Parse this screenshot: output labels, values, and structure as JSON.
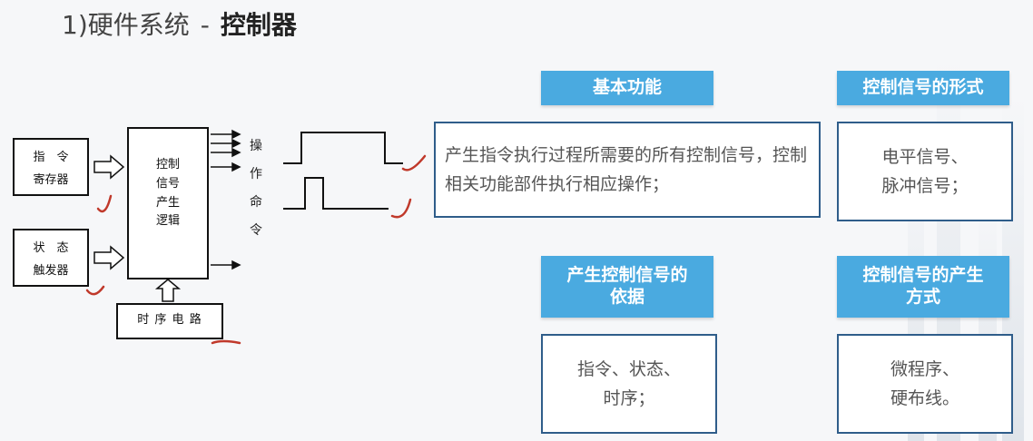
{
  "title": {
    "prefix": "1)硬件系统",
    "separator": "-",
    "emphasis": "控制器"
  },
  "diagram": {
    "instruction_register": [
      "指　令",
      "寄存器"
    ],
    "status_trigger": [
      "状　态",
      "触发器"
    ],
    "control_logic": [
      "控制",
      "信号",
      "产生",
      "逻辑"
    ],
    "timing_circuit": "时 序 电 路",
    "op_command": [
      "操",
      "作",
      "命",
      "令"
    ]
  },
  "cards": {
    "basic_function": {
      "heading": "基本功能",
      "body": "产生指令执行过程所需要的所有控制信号，控制相关功能部件执行相应操作；"
    },
    "signal_form": {
      "heading": "控制信号的形式",
      "body_lines": [
        "电平信号、",
        "脉冲信号；"
      ]
    },
    "signal_basis": {
      "heading_lines": [
        "产生控制信号的",
        "依据"
      ],
      "body_lines": [
        "指令、状态、",
        "时序；"
      ]
    },
    "signal_method": {
      "heading_lines": [
        "控制信号的产生",
        "方式"
      ],
      "body_lines": [
        "微程序、",
        "硬布线。"
      ]
    }
  },
  "colors": {
    "accent": "#4aaae0",
    "box_border": "#2f5d8a",
    "annotation": "#c0392b"
  }
}
